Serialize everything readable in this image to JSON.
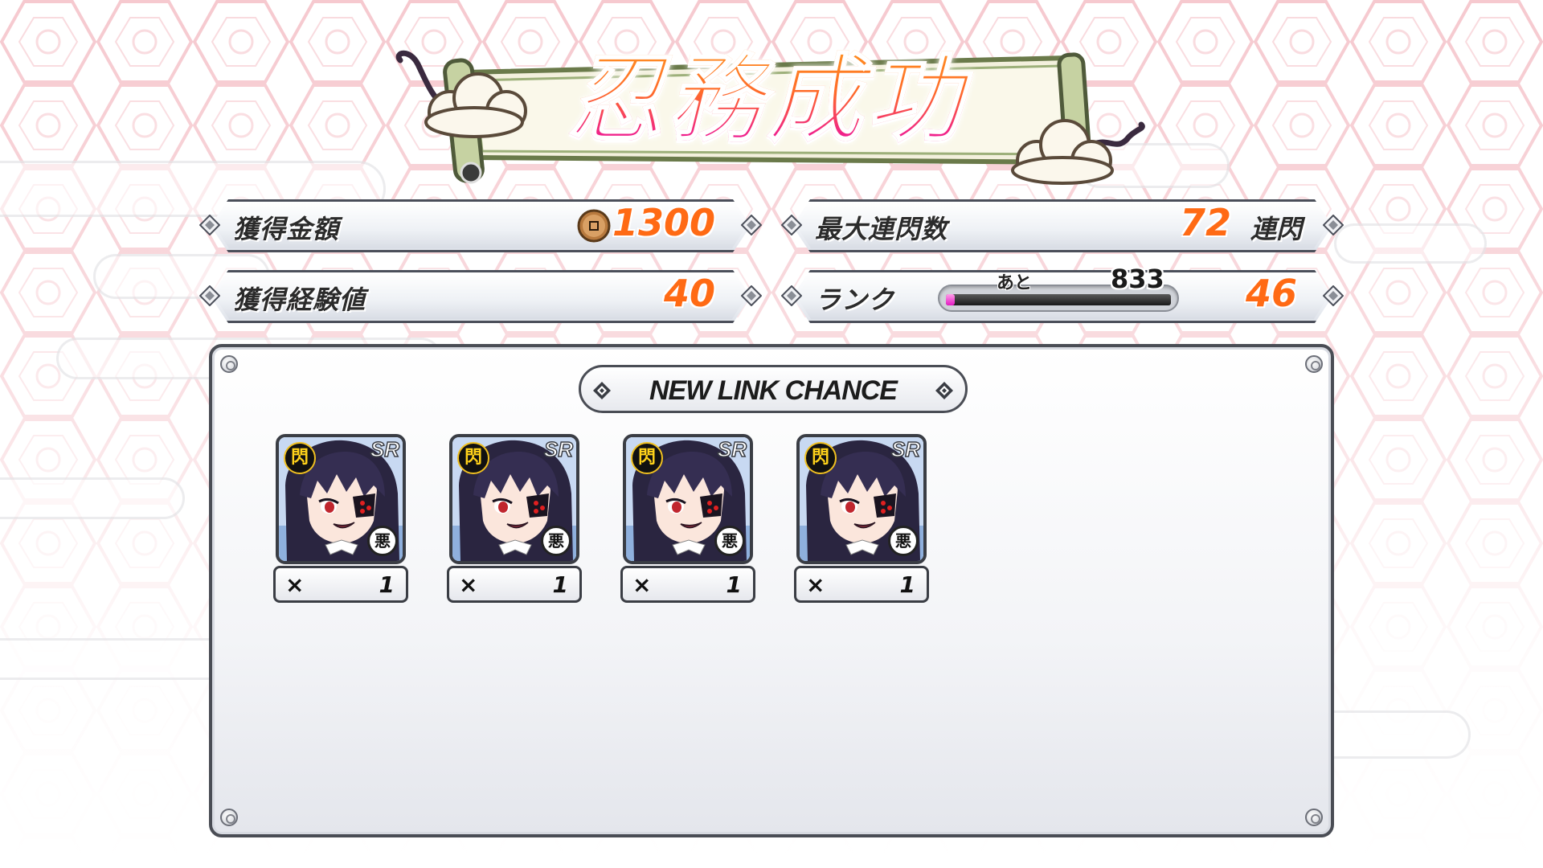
{
  "title": "忍務成功",
  "stats": {
    "money": {
      "label": "獲得金額",
      "value": "1300",
      "icon": "coin-icon"
    },
    "combo": {
      "label": "最大連閃数",
      "value": "72",
      "suffix": "連閃"
    },
    "exp": {
      "label": "獲得経験値",
      "value": "40"
    },
    "rank": {
      "label": "ランク",
      "value": "46",
      "remaining_label": "あと",
      "remaining": "833",
      "progress_fraction": 0.04
    }
  },
  "link_chance": {
    "header": "NEW LINK CHANCE",
    "cards": [
      {
        "rarity": "SR",
        "type_badge": "閃",
        "affiliation_badge": "悪",
        "count_prefix": "×",
        "count": "1"
      },
      {
        "rarity": "SR",
        "type_badge": "閃",
        "affiliation_badge": "悪",
        "count_prefix": "×",
        "count": "1"
      },
      {
        "rarity": "SR",
        "type_badge": "閃",
        "affiliation_badge": "悪",
        "count_prefix": "×",
        "count": "1"
      },
      {
        "rarity": "SR",
        "type_badge": "閃",
        "affiliation_badge": "悪",
        "count_prefix": "×",
        "count": "1"
      }
    ]
  },
  "colors": {
    "value_orange": "#ff6a14",
    "title_top": "#ff9a1e",
    "title_bottom": "#e31a9c",
    "rank_fill": "#e41ac2",
    "frame_dark": "#4a4d55"
  }
}
